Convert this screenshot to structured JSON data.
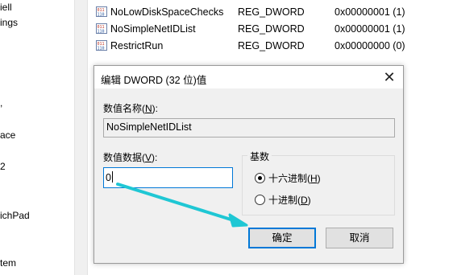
{
  "tree": {
    "items": [
      "iell",
      "ings",
      "ace",
      "2",
      "ichPad",
      "tem"
    ],
    "marks": [
      ","
    ]
  },
  "values": [
    {
      "name": "NoLowDiskSpaceChecks",
      "type": "REG_DWORD",
      "data": "0x00000001 (1)"
    },
    {
      "name": "NoSimpleNetIDList",
      "type": "REG_DWORD",
      "data": "0x00000001 (1)"
    },
    {
      "name": "RestrictRun",
      "type": "REG_DWORD",
      "data": "0x00000000 (0)"
    }
  ],
  "dialog": {
    "title": "编辑 DWORD (32 位)值",
    "close_glyph": "✕",
    "name_label": "数值名称(",
    "name_label_key": "N",
    "name_label_end": "):",
    "name_value": "NoSimpleNetIDList",
    "data_label": "数值数据(",
    "data_label_key": "V",
    "data_label_end": "):",
    "data_value": "0",
    "base_title": "基数",
    "hex_label": "十六进制(",
    "hex_key": "H",
    "hex_end": ")",
    "dec_label": "十进制(",
    "dec_key": "D",
    "dec_end": ")",
    "base_selected": "hex",
    "ok_label": "确定",
    "cancel_label": "取消"
  },
  "colors": {
    "accent": "#0078d7",
    "arrow": "#1fc7d4",
    "dialog_bg": "#f0f0f0"
  }
}
